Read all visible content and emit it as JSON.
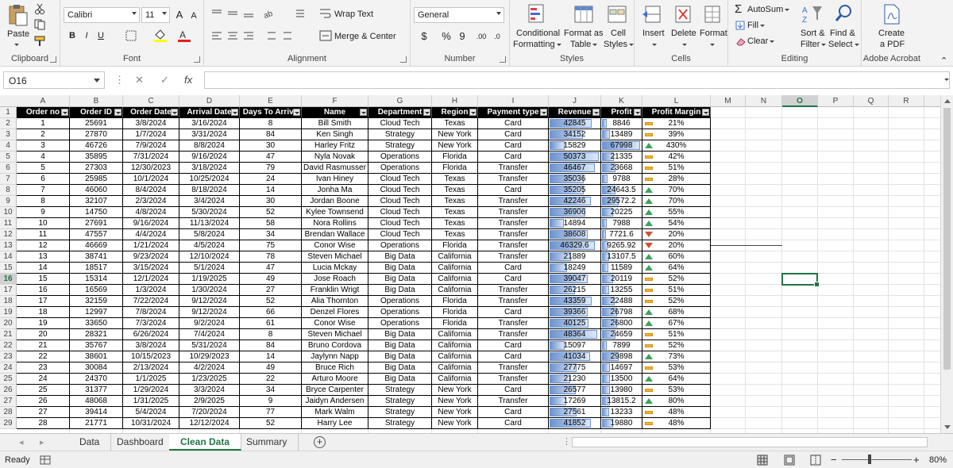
{
  "ribbon": {
    "clipboard": {
      "label": "Clipboard",
      "paste": "Paste"
    },
    "font": {
      "label": "Font",
      "name": "Calibri",
      "size": "11",
      "grow": "A",
      "shrink": "A",
      "bold": "B",
      "italic": "I",
      "underline": "U"
    },
    "alignment": {
      "label": "Alignment",
      "wrap_text": "Wrap Text",
      "merge_center": "Merge & Center"
    },
    "number": {
      "label": "Number",
      "format": "General",
      "currency": "$",
      "percent": "%",
      "comma": "9",
      "inc_dec": ".00",
      "dec_dec": ".0"
    },
    "styles": {
      "label": "Styles",
      "conditional": "Conditional",
      "formatting": "Formatting",
      "format_as": "Format as",
      "table": "Table",
      "cell": "Cell",
      "styles": "Styles"
    },
    "cells": {
      "label": "Cells",
      "insert": "Insert",
      "delete": "Delete",
      "format": "Format"
    },
    "editing": {
      "label": "Editing",
      "autosum": "AutoSum",
      "fill": "Fill",
      "clear": "Clear",
      "sort": "Sort &",
      "filter": "Filter",
      "find": "Find &",
      "select": "Select"
    },
    "acrobat": {
      "label": "Adobe Acrobat",
      "create": "Create",
      "pdf": "a PDF"
    }
  },
  "formula_bar": {
    "name_box": "O16",
    "fx": "fx",
    "value": ""
  },
  "columns": [
    "A",
    "B",
    "C",
    "D",
    "E",
    "F",
    "G",
    "H",
    "I",
    "J",
    "K",
    "L",
    "M",
    "N",
    "O",
    "P",
    "Q",
    "R"
  ],
  "selected_column": "O",
  "selected_row": 16,
  "headers": [
    "Order no",
    "Order ID",
    "Order Date",
    "Arrival Date",
    "Days To Arriva",
    "Name",
    "Department",
    "Region",
    "Payment type",
    "Revenue",
    "Profit",
    "Profit Margin"
  ],
  "rows": [
    [
      "1",
      "25691",
      "3/8/2024",
      "3/16/2024",
      "8",
      "Bill Smith",
      "Cloud Tech",
      "Texas",
      "Card",
      "42845",
      "8846",
      "21%"
    ],
    [
      "2",
      "27870",
      "1/7/2024",
      "3/31/2024",
      "84",
      "Ken Singh",
      "Strategy",
      "New York",
      "Card",
      "34152",
      "13489",
      "39%"
    ],
    [
      "3",
      "46726",
      "7/9/2024",
      "8/8/2024",
      "30",
      "Harley Fritz",
      "Strategy",
      "New York",
      "Card",
      "15829",
      "67998",
      "430%"
    ],
    [
      "4",
      "35895",
      "7/31/2024",
      "9/16/2024",
      "47",
      "Nyla Novak",
      "Operations",
      "Florida",
      "Card",
      "50373",
      "21335",
      "42%"
    ],
    [
      "5",
      "27303",
      "12/30/2023",
      "3/18/2024",
      "79",
      "David Rasmusser",
      "Operations",
      "Florida",
      "Transfer",
      "46467",
      "23668",
      "51%"
    ],
    [
      "6",
      "25985",
      "10/1/2024",
      "10/25/2024",
      "24",
      "Ivan Hiney",
      "Cloud Tech",
      "Texas",
      "Transfer",
      "35036",
      "9788",
      "28%"
    ],
    [
      "7",
      "46060",
      "8/4/2024",
      "8/18/2024",
      "14",
      "Jonha Ma",
      "Cloud Tech",
      "Texas",
      "Card",
      "35205",
      "24643.5",
      "70%"
    ],
    [
      "8",
      "32107",
      "2/3/2024",
      "3/4/2024",
      "30",
      "Jordan Boone",
      "Cloud Tech",
      "Texas",
      "Transfer",
      "42246",
      "29572.2",
      "70%"
    ],
    [
      "9",
      "14750",
      "4/8/2024",
      "5/30/2024",
      "52",
      "Kylee Townsend",
      "Cloud Tech",
      "Texas",
      "Transfer",
      "36906",
      "20225",
      "55%"
    ],
    [
      "10",
      "27691",
      "9/16/2024",
      "11/13/2024",
      "58",
      "Nora Rollins",
      "Cloud Tech",
      "Texas",
      "Transfer",
      "14894",
      "7988",
      "54%"
    ],
    [
      "11",
      "47557",
      "4/4/2024",
      "5/8/2024",
      "34",
      "Brendan Wallace",
      "Cloud Tech",
      "Texas",
      "Transfer",
      "38608",
      "7721.6",
      "20%"
    ],
    [
      "12",
      "46669",
      "1/21/2024",
      "4/5/2024",
      "75",
      "Conor Wise",
      "Operations",
      "Florida",
      "Transfer",
      "46329.6",
      "9265.92",
      "20%"
    ],
    [
      "13",
      "38741",
      "9/23/2024",
      "12/10/2024",
      "78",
      "Steven Michael",
      "Big Data",
      "California",
      "Transfer",
      "21889",
      "13107.5",
      "60%"
    ],
    [
      "14",
      "18517",
      "3/15/2024",
      "5/1/2024",
      "47",
      "Lucia Mckay",
      "Big Data",
      "California",
      "Card",
      "18249",
      "11589",
      "64%"
    ],
    [
      "15",
      "15314",
      "12/1/2024",
      "1/19/2025",
      "49",
      "Jose Roach",
      "Big Data",
      "California",
      "Card",
      "39047",
      "20119",
      "52%"
    ],
    [
      "16",
      "16569",
      "1/3/2024",
      "1/30/2024",
      "27",
      "Franklin Wrigt",
      "Big Data",
      "California",
      "Transfer",
      "26215",
      "13255",
      "51%"
    ],
    [
      "17",
      "32159",
      "7/22/2024",
      "9/12/2024",
      "52",
      "Alia Thornton",
      "Operations",
      "Florida",
      "Transfer",
      "43359",
      "22488",
      "52%"
    ],
    [
      "18",
      "12997",
      "7/8/2024",
      "9/12/2024",
      "66",
      "Denzel Flores",
      "Operations",
      "Florida",
      "Card",
      "39366",
      "26798",
      "68%"
    ],
    [
      "19",
      "33650",
      "7/3/2024",
      "9/2/2024",
      "61",
      "Conor Wise",
      "Operations",
      "Florida",
      "Transfer",
      "40125",
      "26800",
      "67%"
    ],
    [
      "20",
      "28321",
      "6/26/2024",
      "7/4/2024",
      "8",
      "Steven Michael",
      "Big Data",
      "California",
      "Transfer",
      "48364",
      "24659",
      "51%"
    ],
    [
      "21",
      "35767",
      "3/8/2024",
      "5/31/2024",
      "84",
      "Bruno Cordova",
      "Big Data",
      "California",
      "Card",
      "15097",
      "7899",
      "52%"
    ],
    [
      "22",
      "38601",
      "10/15/2023",
      "10/29/2023",
      "14",
      "Jaylynn Napp",
      "Big Data",
      "California",
      "Card",
      "41034",
      "29898",
      "73%"
    ],
    [
      "23",
      "30084",
      "2/13/2024",
      "4/2/2024",
      "49",
      "Bruce Rich",
      "Big Data",
      "California",
      "Transfer",
      "27775",
      "14697",
      "53%"
    ],
    [
      "24",
      "24370",
      "1/1/2025",
      "1/23/2025",
      "22",
      "Arturo Moore",
      "Big Data",
      "California",
      "Transfer",
      "21230",
      "13500",
      "64%"
    ],
    [
      "25",
      "31377",
      "1/29/2024",
      "3/3/2024",
      "34",
      "Bryce Carpenter",
      "Strategy",
      "New York",
      "Card",
      "26577",
      "13980",
      "53%"
    ],
    [
      "26",
      "48068",
      "1/31/2025",
      "2/9/2025",
      "9",
      "Jaidyn Andersen",
      "Strategy",
      "New York",
      "Transfer",
      "17269",
      "13815.2",
      "80%"
    ],
    [
      "27",
      "39414",
      "5/4/2024",
      "7/20/2024",
      "77",
      "Mark Walm",
      "Strategy",
      "New York",
      "Card",
      "27561",
      "13233",
      "48%"
    ],
    [
      "28",
      "21771",
      "10/31/2024",
      "12/12/2024",
      "52",
      "Harry Lee",
      "Strategy",
      "New York",
      "Card",
      "41852",
      "19880",
      "48%"
    ]
  ],
  "margin_icons": [
    "dash",
    "dash",
    "up",
    "dash",
    "dash",
    "dash",
    "up",
    "up",
    "up",
    "up",
    "down",
    "down",
    "up",
    "up",
    "dash",
    "dash",
    "dash",
    "up",
    "up",
    "dash",
    "dash",
    "up",
    "dash",
    "up",
    "dash",
    "up",
    "dash",
    "dash"
  ],
  "tabs": [
    "Data",
    "Dashboard",
    "Clean Data",
    "Summary"
  ],
  "active_tab": "Clean Data",
  "status": {
    "ready": "Ready",
    "zoom": "80%"
  }
}
